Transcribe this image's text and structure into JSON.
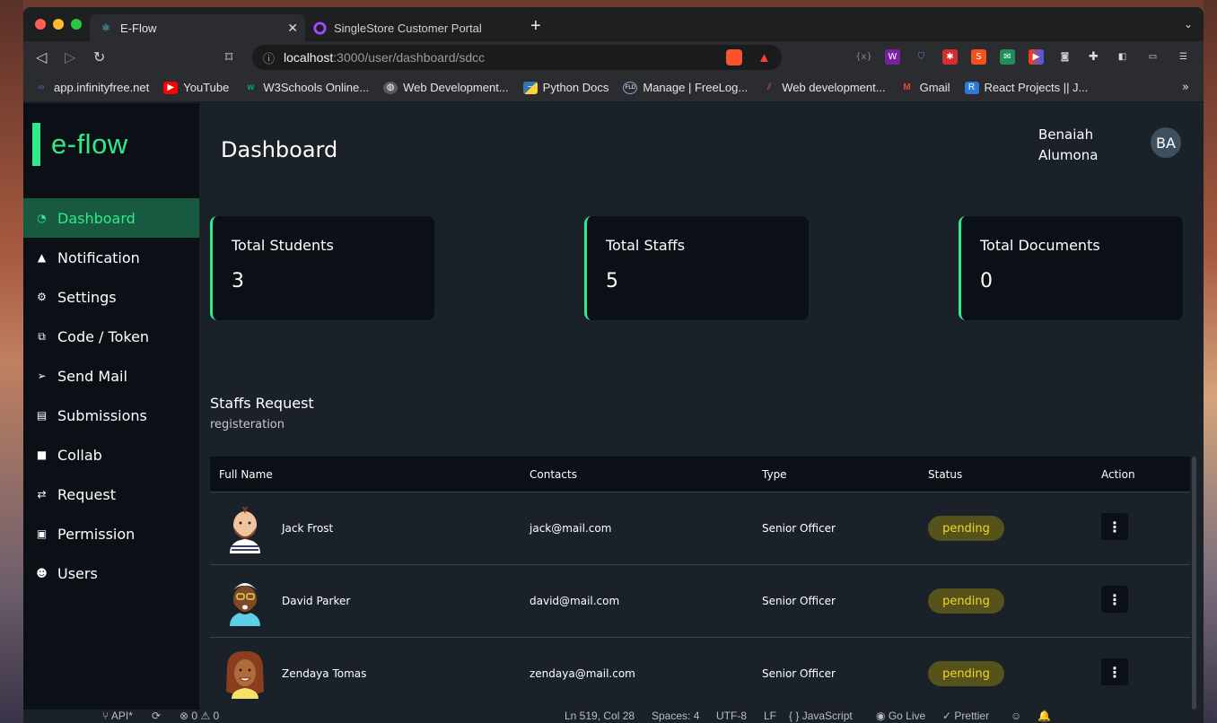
{
  "browser": {
    "tabs": [
      {
        "title": "E-Flow",
        "active": true,
        "icon": "react-icon"
      },
      {
        "title": "SingleStore Customer Portal",
        "active": false,
        "icon": "singlestore-icon"
      }
    ],
    "url_host": "localhost",
    "url_path": ":3000/user/dashboard/sdcc",
    "bookmarks": [
      {
        "label": "app.infinityfree.net",
        "icon": "infinityfree-icon",
        "color": "#3a6fd8"
      },
      {
        "label": "YouTube",
        "icon": "youtube-icon",
        "color": "#ff0000"
      },
      {
        "label": "W3Schools Online...",
        "icon": "w3schools-icon",
        "color": "#04aa6d"
      },
      {
        "label": "Web Development...",
        "icon": "globe-icon",
        "color": "#5a5a5a"
      },
      {
        "label": "Python Docs",
        "icon": "python-icon",
        "color": "#3776ab"
      },
      {
        "label": "Manage | FreeLog...",
        "icon": "freelogo-icon",
        "color": "#2a6ab0"
      },
      {
        "label": "Web development...",
        "icon": "mdn-icon",
        "color": "#d65a32"
      },
      {
        "label": "Gmail",
        "icon": "gmail-icon",
        "color": "#ea4335"
      },
      {
        "label": "React Projects || J...",
        "icon": "react-projects-icon",
        "color": "#2a7bd8"
      }
    ]
  },
  "app": {
    "logo": "e-flow",
    "accent": "#2eea8b",
    "nav": [
      {
        "label": "Dashboard",
        "icon": "dashboard-icon",
        "glyph": "◔",
        "active": true
      },
      {
        "label": "Notification",
        "icon": "bell-icon",
        "glyph": "🔔",
        "active": false
      },
      {
        "label": "Settings",
        "icon": "gear-icon",
        "glyph": "⚙",
        "active": false
      },
      {
        "label": "Code / Token",
        "icon": "code-token-icon",
        "glyph": "⧉",
        "active": false
      },
      {
        "label": "Send Mail",
        "icon": "send-icon",
        "glyph": "➤",
        "active": false
      },
      {
        "label": "Submissions",
        "icon": "document-icon",
        "glyph": "▤",
        "active": false
      },
      {
        "label": "Collab",
        "icon": "video-icon",
        "glyph": "■",
        "active": false
      },
      {
        "label": "Request",
        "icon": "request-icon",
        "glyph": "⇄",
        "active": false
      },
      {
        "label": "Permission",
        "icon": "lock-icon",
        "glyph": "🔒",
        "active": false
      },
      {
        "label": "Users",
        "icon": "users-icon",
        "glyph": "☻",
        "active": false
      }
    ],
    "header": {
      "title": "Dashboard",
      "user_first": "Benaiah",
      "user_last": "Alumona",
      "initials": "BA"
    },
    "stats": [
      {
        "label": "Total Students",
        "value": "3"
      },
      {
        "label": "Total Staffs",
        "value": "5"
      },
      {
        "label": "Total Documents",
        "value": "0"
      }
    ],
    "requests": {
      "title": "Staffs Request",
      "subtitle": "registeration",
      "columns": [
        "Full Name",
        "Contacts",
        "Type",
        "Status",
        "Action"
      ],
      "rows": [
        {
          "name": "Jack Frost",
          "contact": "jack@mail.com",
          "type": "Senior Officer",
          "status": "pending"
        },
        {
          "name": "David Parker",
          "contact": "david@mail.com",
          "type": "Senior Officer",
          "status": "pending"
        },
        {
          "name": "Zendaya Tomas",
          "contact": "zendaya@mail.com",
          "type": "Senior Officer",
          "status": "pending"
        }
      ]
    }
  },
  "statusbar": {
    "branch": "API*",
    "problems": "0",
    "warnings": "0",
    "position": "Ln 519, Col 28",
    "spaces": "Spaces: 4",
    "encoding": "UTF-8",
    "eol": "LF",
    "language": "JavaScript",
    "golive": "Go Live",
    "prettier": "Prettier"
  }
}
